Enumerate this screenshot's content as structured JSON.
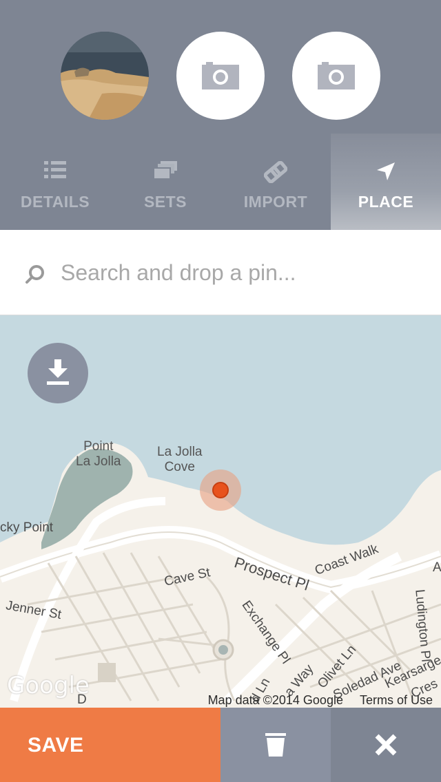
{
  "photos": [
    {
      "kind": "photo",
      "icon": "photo-thumbnail"
    },
    {
      "kind": "empty",
      "icon": "camera-icon"
    },
    {
      "kind": "empty",
      "icon": "camera-icon"
    }
  ],
  "tabs": [
    {
      "label": "DETAILS",
      "icon": "list-icon",
      "active": false
    },
    {
      "label": "SETS",
      "icon": "sets-icon",
      "active": false
    },
    {
      "label": "IMPORT",
      "icon": "import-link-icon",
      "active": false
    },
    {
      "label": "PLACE",
      "icon": "location-arrow-icon",
      "active": true
    }
  ],
  "search": {
    "placeholder": "Search and drop a pin...",
    "icon": "search-icon"
  },
  "map": {
    "labels": {
      "point_la_jolla": "Point\nLa Jolla",
      "la_jolla_cove": "La Jolla\nCove",
      "rocky_point": "cky Point",
      "coast_walk": "Coast Walk",
      "prospect_pl": "Prospect Pl",
      "cave_st": "Cave St",
      "jenner_st": "Jenner St",
      "exchange_pl": "Exchange Pl",
      "ludington_pl": "Ludington Pl",
      "olivet_ln": "Olivet Ln",
      "soledad_ave": "Soledad Ave",
      "kearsarge": "Kearsarge",
      "la_way": "a Way",
      "d_ln": "d Ln",
      "cres": "Cres",
      "a_label": "A",
      "d_label": "D"
    },
    "logo": "Google",
    "attribution": "Map data ©2014 Google",
    "terms": "Terms of Use",
    "colors": {
      "water": "#c5d9e0",
      "land": "#f5f1ea",
      "park": "#9fb3ae",
      "pin": "#e8521c"
    }
  },
  "footer": {
    "save_label": "SAVE",
    "trash_icon": "trash-icon",
    "close_icon": "close-icon"
  },
  "colors": {
    "header": "#7e8593",
    "accent": "#ef7b45",
    "button_gray": "#8a91a1"
  }
}
